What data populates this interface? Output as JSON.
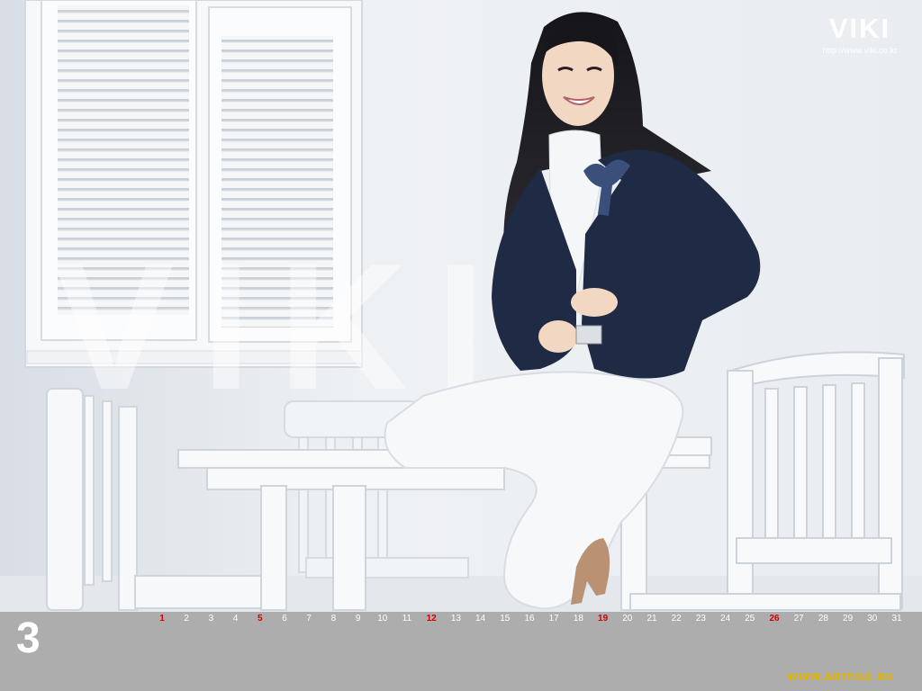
{
  "brand": {
    "logo": "VIKI",
    "url": "http://www.viki.co.kr"
  },
  "calendar": {
    "month": "3",
    "days": [
      {
        "n": "1",
        "holiday": true
      },
      {
        "n": "2",
        "holiday": false
      },
      {
        "n": "3",
        "holiday": false
      },
      {
        "n": "4",
        "holiday": false
      },
      {
        "n": "5",
        "holiday": true
      },
      {
        "n": "6",
        "holiday": false
      },
      {
        "n": "7",
        "holiday": false
      },
      {
        "n": "8",
        "holiday": false
      },
      {
        "n": "9",
        "holiday": false
      },
      {
        "n": "10",
        "holiday": false
      },
      {
        "n": "11",
        "holiday": false
      },
      {
        "n": "12",
        "holiday": true
      },
      {
        "n": "13",
        "holiday": false
      },
      {
        "n": "14",
        "holiday": false
      },
      {
        "n": "15",
        "holiday": false
      },
      {
        "n": "16",
        "holiday": false
      },
      {
        "n": "17",
        "holiday": false
      },
      {
        "n": "18",
        "holiday": false
      },
      {
        "n": "19",
        "holiday": true
      },
      {
        "n": "20",
        "holiday": false
      },
      {
        "n": "21",
        "holiday": false
      },
      {
        "n": "22",
        "holiday": false
      },
      {
        "n": "23",
        "holiday": false
      },
      {
        "n": "24",
        "holiday": false
      },
      {
        "n": "25",
        "holiday": false
      },
      {
        "n": "26",
        "holiday": true
      },
      {
        "n": "27",
        "holiday": false
      },
      {
        "n": "28",
        "holiday": false
      },
      {
        "n": "29",
        "holiday": false
      },
      {
        "n": "30",
        "holiday": false
      },
      {
        "n": "31",
        "holiday": false
      }
    ]
  },
  "watermark": {
    "text": "VIKI"
  },
  "credit": {
    "text": "WWW.ARTFILE.RU"
  },
  "colors": {
    "calendar_bar": "#adadad",
    "holiday": "#d20000",
    "jacket": "#1f2a44",
    "credit": "#e2b400"
  }
}
